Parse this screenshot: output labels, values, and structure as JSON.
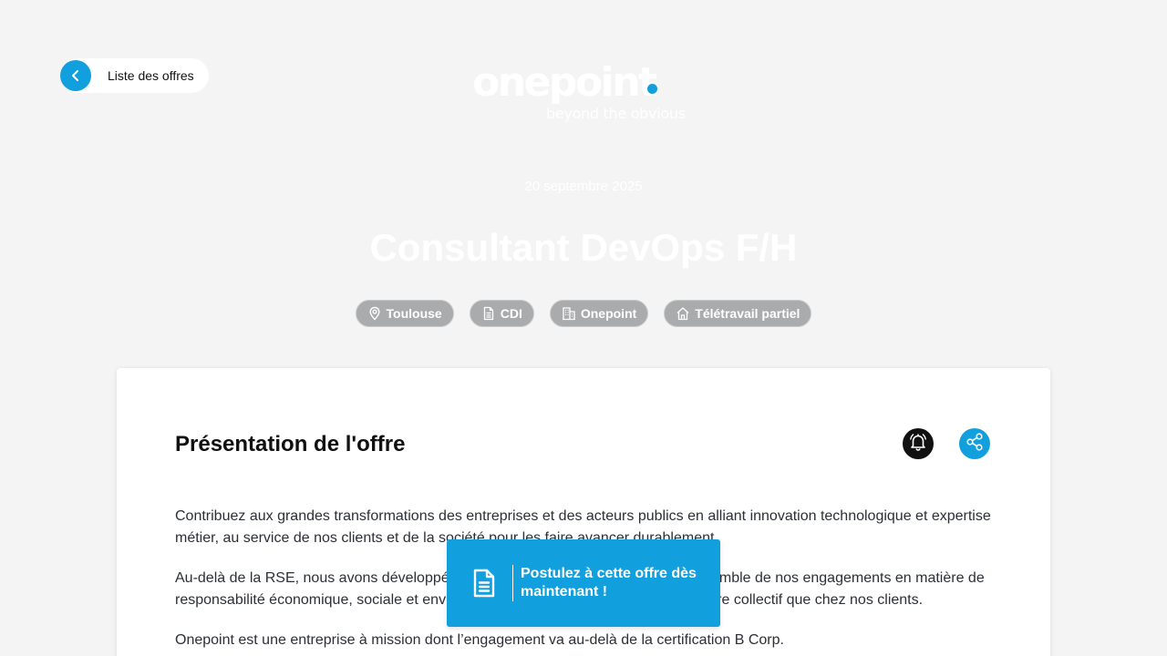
{
  "nav": {
    "back_label": "Liste des offres"
  },
  "logo": {
    "wordmark": "onepoint",
    "tagline": "beyond the obvious"
  },
  "job": {
    "date": "20 septembre 2025",
    "title": "Consultant DevOps F/H",
    "tags": [
      {
        "label": "Toulouse",
        "icon": "location-pin-icon"
      },
      {
        "label": "CDI",
        "icon": "document-icon"
      },
      {
        "label": "Onepoint",
        "icon": "building-icon"
      },
      {
        "label": "Télétravail partiel",
        "icon": "home-icon"
      }
    ]
  },
  "offer": {
    "section_title": "Présentation de l'offre",
    "alert_icon": "bell-icon",
    "share_icon": "share-icon",
    "paragraphs": [
      "Contribuez aux grandes transformations des entreprises et des acteurs publics en alliant innovation technologique et expertise métier, au service de nos clients et de la société pour les faire avancer durablement.",
      "Au-delà de la RSE, nous avons développé une démarche globale qui englobe l’ensemble de nos engagements en matière de responsabilité économique, sociale et environnementale, en agissant au sein de notre collectif que chez nos clients.",
      "Onepoint est une entreprise à mission dont l’engagement va au-delà de la certification B Corp."
    ]
  },
  "apply": {
    "label": "Postulez à cette offre dès maintenant !"
  },
  "colors": {
    "accent": "#119fdd",
    "background": "#f4f4f4",
    "tag_bg": "#a9abad"
  }
}
